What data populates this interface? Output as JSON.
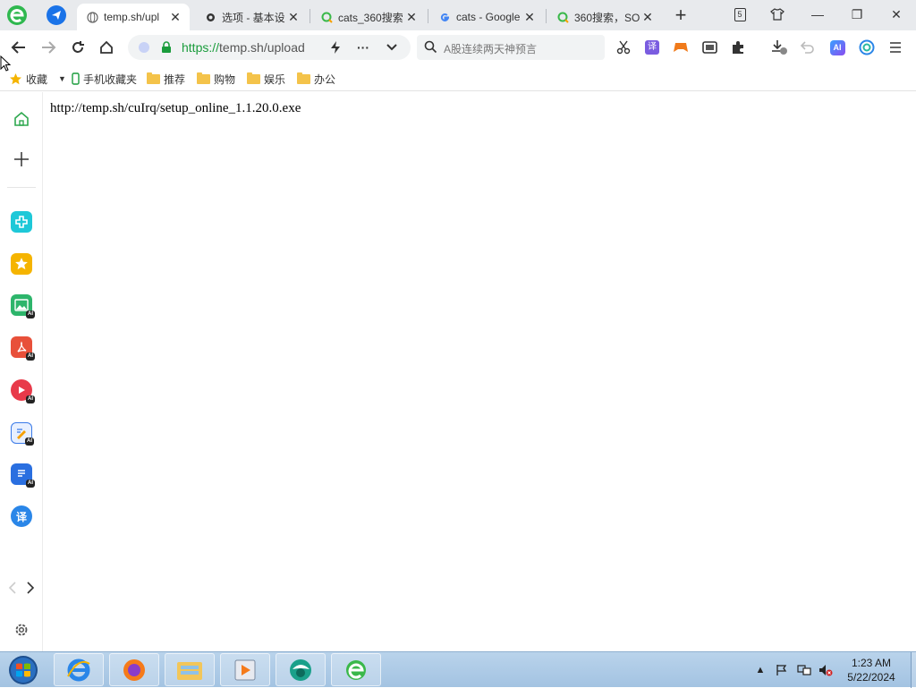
{
  "tabs": [
    {
      "label": "",
      "pinned": true,
      "icon": "telegram-icon"
    },
    {
      "label": "temp.sh/upl",
      "active": true,
      "icon": "globe-icon"
    },
    {
      "label": "选项 - 基本设",
      "active": false,
      "icon": "gear-icon"
    },
    {
      "label": "cats_360搜索",
      "active": false,
      "icon": "360-search-icon"
    },
    {
      "label": "cats - Google",
      "active": false,
      "icon": "google-icon"
    },
    {
      "label": "360搜索，SO",
      "active": false,
      "icon": "360-search-icon"
    }
  ],
  "window_controls": {
    "skin": "5",
    "minimize": "—",
    "restore": "❐",
    "close": "✕"
  },
  "address": {
    "scheme": "https://",
    "rest": "temp.sh/upload"
  },
  "search": {
    "placeholder": "A股连续两天神预言"
  },
  "toolbar_icons": [
    "scissors-icon",
    "translate-icon",
    "game-icon",
    "wallet-icon",
    "extensions-icon",
    "download-icon",
    "undo-icon",
    "ai-icon",
    "360-icon",
    "menu-icon"
  ],
  "bookmarks": {
    "items": [
      {
        "label": "收藏",
        "icon": "star-icon"
      },
      {
        "label": "手机收藏夹",
        "icon": "phone-icon"
      },
      {
        "label": "推荐",
        "icon": "folder-icon"
      },
      {
        "label": "购物",
        "icon": "folder-icon"
      },
      {
        "label": "娱乐",
        "icon": "folder-icon"
      },
      {
        "label": "办公",
        "icon": "folder-icon"
      }
    ]
  },
  "side_panel": {
    "items": [
      {
        "name": "home-icon"
      },
      {
        "name": "add-icon"
      },
      {
        "name": "plus-tool-icon",
        "color": "#1ec8d8"
      },
      {
        "name": "favorites-star-icon",
        "color": "#f5b400"
      },
      {
        "name": "ai-image-icon",
        "color": "#2db56b",
        "ai": "AI"
      },
      {
        "name": "ai-pdf-icon",
        "color": "#e8503a",
        "ai": "AI"
      },
      {
        "name": "ai-video-icon",
        "color": "#e83a4a",
        "ai": "AI"
      },
      {
        "name": "ai-write-icon",
        "color": "#3a7ae8",
        "ai": "AI"
      },
      {
        "name": "ai-doc-icon",
        "color": "#2a6fe0",
        "ai": "AI"
      },
      {
        "name": "translate-icon",
        "color": "#2a86e8",
        "text": "译"
      }
    ]
  },
  "content": {
    "text": "http://temp.sh/cuIrq/setup_online_1.1.20.0.exe"
  },
  "taskbar": {
    "apps": [
      "ie-icon",
      "firefox-icon",
      "explorer-icon",
      "media-player-icon",
      "360-browser-icon",
      "ie-icon"
    ],
    "time": "1:23 AM",
    "date": "5/22/2024"
  }
}
